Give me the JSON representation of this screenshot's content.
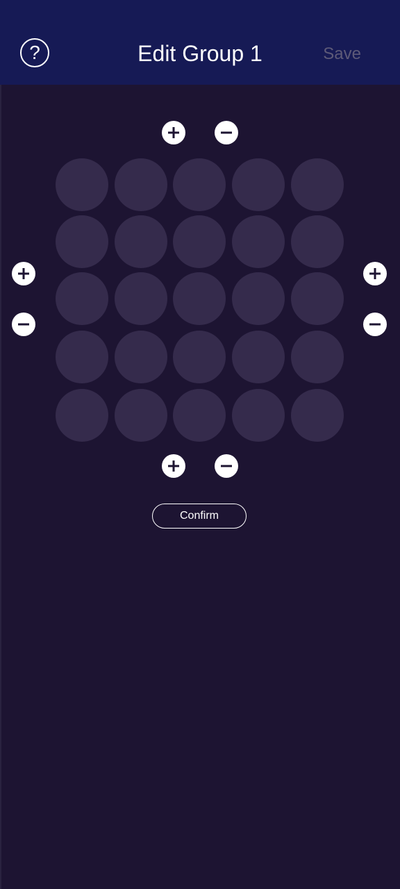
{
  "header": {
    "title": "Edit Group 1",
    "help_icon": "question-mark-circle-icon",
    "save_label": "Save"
  },
  "grid": {
    "rows": 5,
    "columns": 5,
    "cell_color": "#352b4c"
  },
  "controls": {
    "add_icon": "plus-circle-icon",
    "remove_icon": "minus-circle-icon"
  },
  "confirm_label": "Confirm",
  "colors": {
    "header_bg": "#161a55",
    "page_bg": "#1d1432",
    "save_disabled": "#5d5a78"
  }
}
